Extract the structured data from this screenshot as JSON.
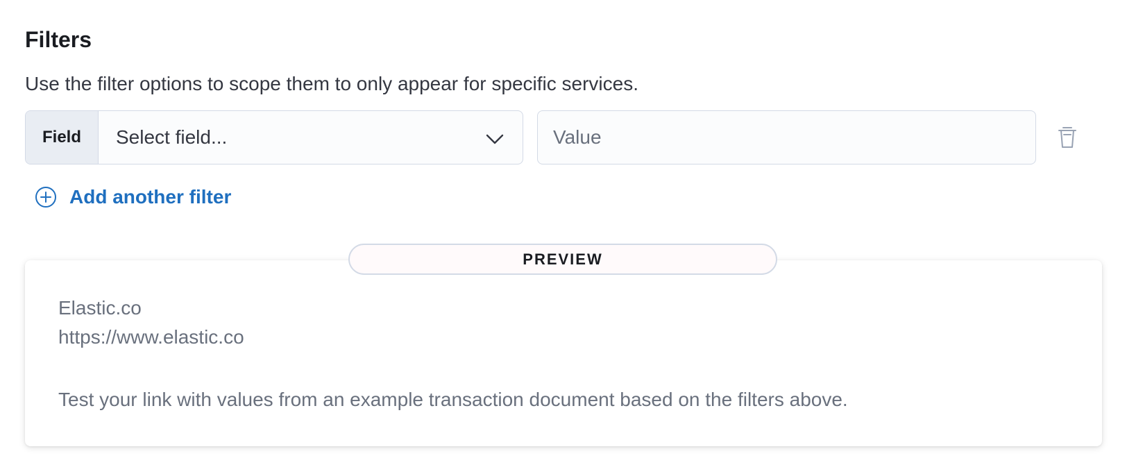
{
  "section": {
    "title": "Filters",
    "description": "Use the filter options to scope them to only appear for specific services."
  },
  "filter": {
    "field_prepend": "Field",
    "field_select_value": "Select field...",
    "value_placeholder": "Value"
  },
  "actions": {
    "add_filter_label": "Add another filter"
  },
  "preview": {
    "badge": "PREVIEW",
    "link_label": "Elastic.co",
    "link_url": "https://www.elastic.co",
    "help_text": "Test your link with values from an example transaction document based on the filters above."
  },
  "icons": {
    "chevron": "chevron-down-icon",
    "trash": "trash-icon",
    "add": "plus-in-circle-icon"
  },
  "colors": {
    "accent": "#1f6fbf",
    "border": "#d3dae6",
    "subdued_text": "#69707d",
    "disabled_icon": "#98a2b3"
  }
}
